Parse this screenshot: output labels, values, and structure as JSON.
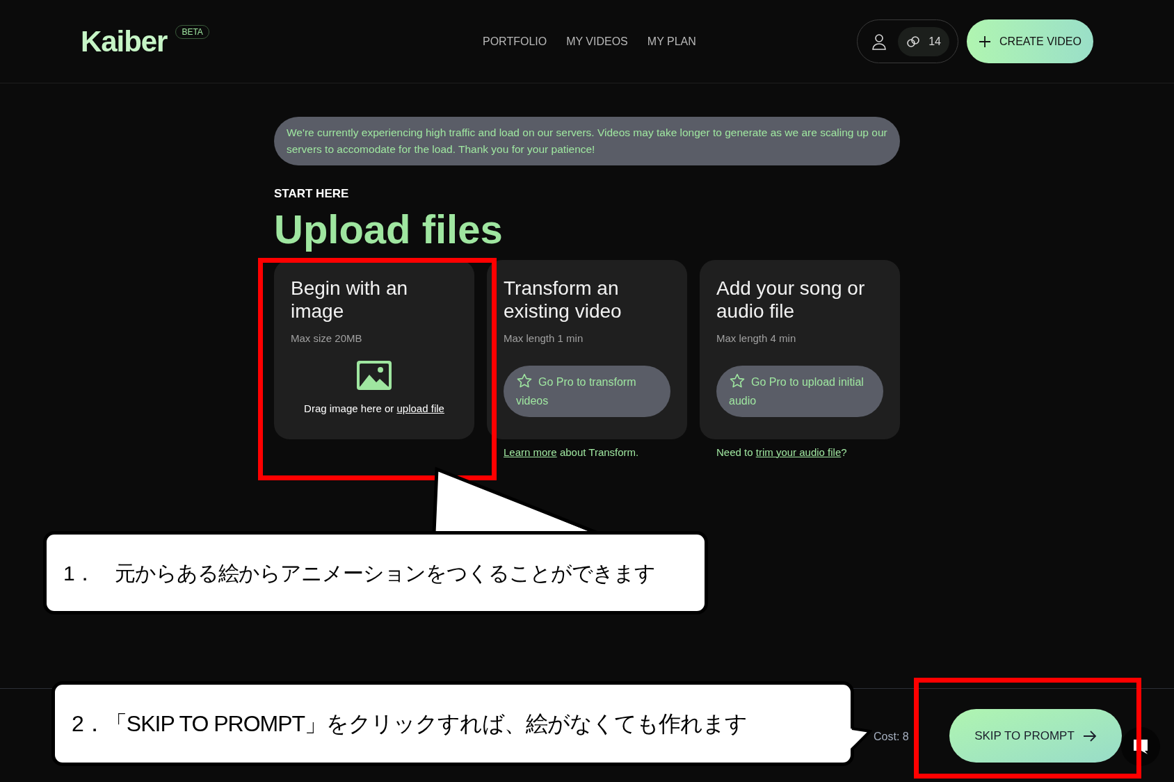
{
  "header": {
    "logo": "Kaiber",
    "badge": "BETA",
    "nav": [
      "PORTFOLIO",
      "MY VIDEOS",
      "MY PLAN"
    ],
    "credits": "14",
    "create_button": "CREATE VIDEO"
  },
  "notice": "We're currently experiencing high traffic and load on our servers. Videos may take longer to generate as we are scaling up our servers to accomodate for the load. Thank you for your patience!",
  "eyebrow": "START HERE",
  "title": "Upload files",
  "cards": [
    {
      "kind": "upload",
      "title": "Begin with an image",
      "subtitle": "Max size 20MB",
      "drop_text": "Drag image here or",
      "drop_link": "upload file"
    },
    {
      "kind": "pro",
      "title": "Transform an existing video",
      "subtitle": "Max length 1 min",
      "button": "Go Pro to transform videos",
      "footnote": [
        {
          "text": "Learn more",
          "link": true
        },
        {
          "text": " about Transform.",
          "link": false
        }
      ]
    },
    {
      "kind": "pro",
      "title": "Add your song or audio file",
      "subtitle": "Max length 4 min",
      "button": "Go Pro to upload initial audio",
      "footnote": [
        {
          "text": "Need to ",
          "link": false
        },
        {
          "text": "trim your audio file",
          "link": true
        },
        {
          "text": "?",
          "link": false
        }
      ]
    }
  ],
  "footer": {
    "cost": "Cost: 8",
    "skip_button": "SKIP TO PROMPT"
  },
  "annotations": [
    "1．　元からある絵からアニメーションをつくることができます",
    "2．「SKIP TO PROMPT」をクリックすれば、絵がなくても作れます"
  ]
}
